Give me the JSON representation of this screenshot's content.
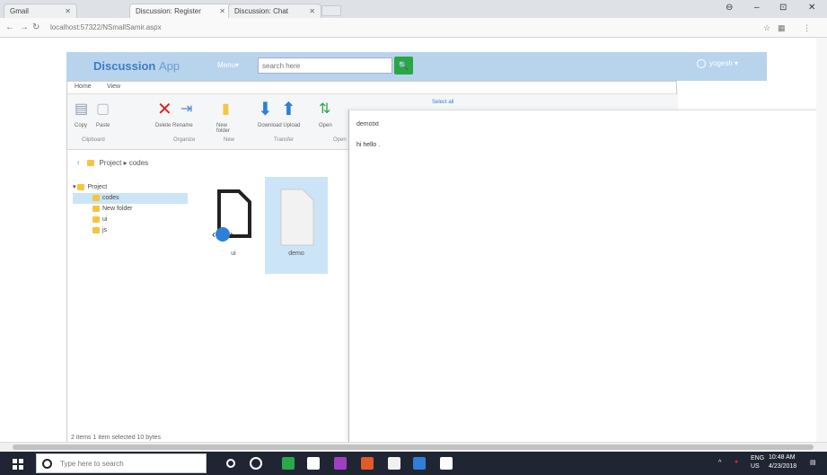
{
  "browser": {
    "tabs": [
      {
        "label": "Gmail",
        "active": false
      },
      {
        "label": "Discussion: Register",
        "active": true
      },
      {
        "label": "Discussion: Chat",
        "active": false
      }
    ],
    "url": "localhost:57322/NSmallSamir.aspx",
    "window_controls": {
      "user": "⊖",
      "minimize": "–",
      "maximize": "⊡",
      "close": "✕"
    }
  },
  "app": {
    "brand_main": "Discussion",
    "brand_sub": "App",
    "menu_label": "Menu▾",
    "search_placeholder": "search here",
    "search_button": "🔍",
    "user_label": "yogesh ▾"
  },
  "file_manager": {
    "ribbon_tabs": [
      "Home",
      "View"
    ],
    "ribbon_groups": [
      "Clipboard",
      "Organize",
      "New",
      "Transfer",
      "Open"
    ],
    "ribbon_buttons": {
      "copy": "Copy",
      "paste": "Paste",
      "delete_rename": "Delete  Rename",
      "new_folder": "New folder",
      "download_upload": "Download  Upload",
      "open": "Open",
      "select_all": "Select all"
    },
    "breadcrumb": "Project ▸ codes",
    "tree": [
      {
        "label": "Project",
        "level": 0,
        "selected": false
      },
      {
        "label": "codes",
        "level": 1,
        "selected": true
      },
      {
        "label": "New folder",
        "level": 1,
        "selected": false
      },
      {
        "label": "ui",
        "level": 1,
        "selected": false
      },
      {
        "label": "js",
        "level": 1,
        "selected": false
      }
    ],
    "files": [
      {
        "name": "ui",
        "selected": false
      },
      {
        "name": "demo",
        "selected": true
      }
    ],
    "status": "2 items    1 item selected  10 bytes"
  },
  "chat": {
    "name": "demotxt",
    "message": "hi hello ."
  },
  "taskbar": {
    "search_placeholder": "Type here to search",
    "tray_lang": "ENG\nUS",
    "time": "10:48 AM",
    "date": "4/23/2018"
  },
  "colors": {
    "header": "#b8d4ec",
    "brand": "#3f7cc1",
    "search_btn": "#28a745",
    "selection": "#cce4f7",
    "taskbar": "#1f2533"
  }
}
